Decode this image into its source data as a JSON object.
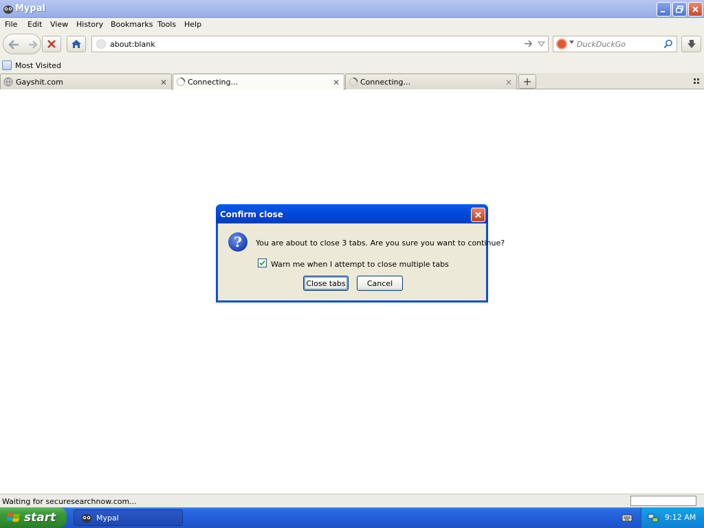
{
  "window": {
    "title": "Mypal"
  },
  "menu": [
    "File",
    "Edit",
    "View",
    "History",
    "Bookmarks",
    "Tools",
    "Help"
  ],
  "address_bar": {
    "url": "about:blank"
  },
  "search": {
    "placeholder": "DuckDuckGo",
    "engine_icon": "duckduckgo-icon"
  },
  "bookmarks": {
    "most_visited": "Most Visited"
  },
  "tabs": [
    {
      "label": "Gayshit.com",
      "state": "loaded"
    },
    {
      "label": "Connecting...",
      "state": "loading"
    },
    {
      "label": "Connecting...",
      "state": "loading"
    }
  ],
  "status": {
    "text": "Waiting for securesearchnow.com..."
  },
  "taskbar": {
    "start_label": "start",
    "task_label": "Mypal",
    "clock": "9:12 AM"
  },
  "dialog": {
    "title": "Confirm close",
    "message": "You are about to close 3 tabs. Are you sure you want to continue?",
    "checkbox_label": "Warn me when I attempt to close multiple tabs",
    "checkbox_checked": true,
    "primary_button": "Close tabs",
    "cancel_button": "Cancel"
  },
  "colors": {
    "titlebar_inactive": "#a9bbee",
    "dialog_titlebar": "#0047d8",
    "taskbar": "#245edb",
    "start_button": "#3c9a3a",
    "stop_icon": "#c0392b"
  }
}
